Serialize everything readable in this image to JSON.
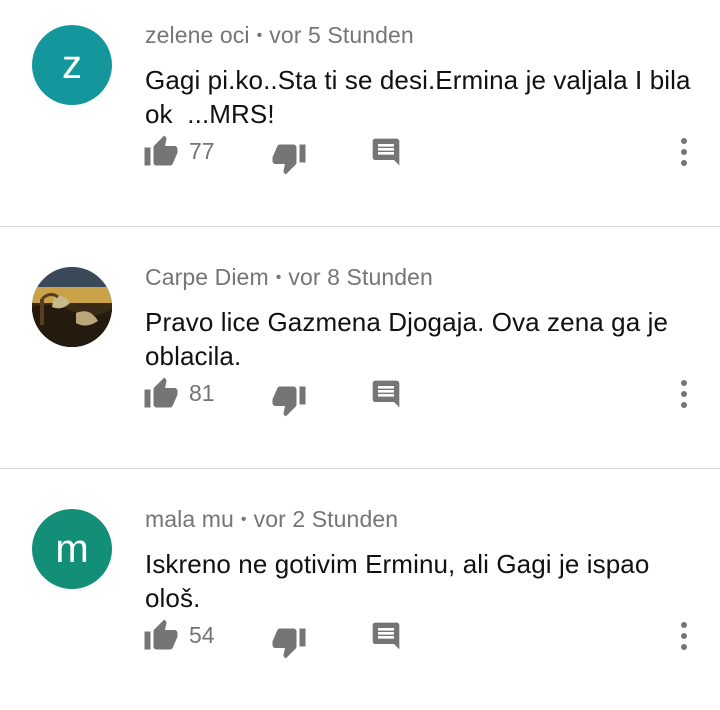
{
  "comments": [
    {
      "author": "zelene oci",
      "separator": "•",
      "time": "vor 5 Stunden",
      "text": "Gagi pi.ko..Sta ti se desi.Ermina je valjala I bila ok  ...MRS!",
      "likes": "77",
      "avatar_letter": "z",
      "avatar_color": "#13979c"
    },
    {
      "author": "Carpe Diem",
      "separator": "•",
      "time": "vor 8 Stunden",
      "text": "Pravo lice Gazmena Djogaja. Ova zena ga je oblacila.",
      "likes": "81",
      "avatar_letter": "",
      "avatar_color": "#2a2418"
    },
    {
      "author": "mala mu",
      "separator": "•",
      "time": "vor 2 Stunden",
      "text": "Iskreno ne gotivim Erminu, ali Gagi je ispao ološ.",
      "likes": "54",
      "avatar_letter": "m",
      "avatar_color": "#148f77"
    }
  ],
  "icons": {
    "like": "thumb-up-icon",
    "dislike": "thumb-down-icon",
    "reply": "reply-comment-icon",
    "more": "more-vertical-icon"
  },
  "colors": {
    "icon_gray": "#757575",
    "divider": "#d9d9d9"
  }
}
